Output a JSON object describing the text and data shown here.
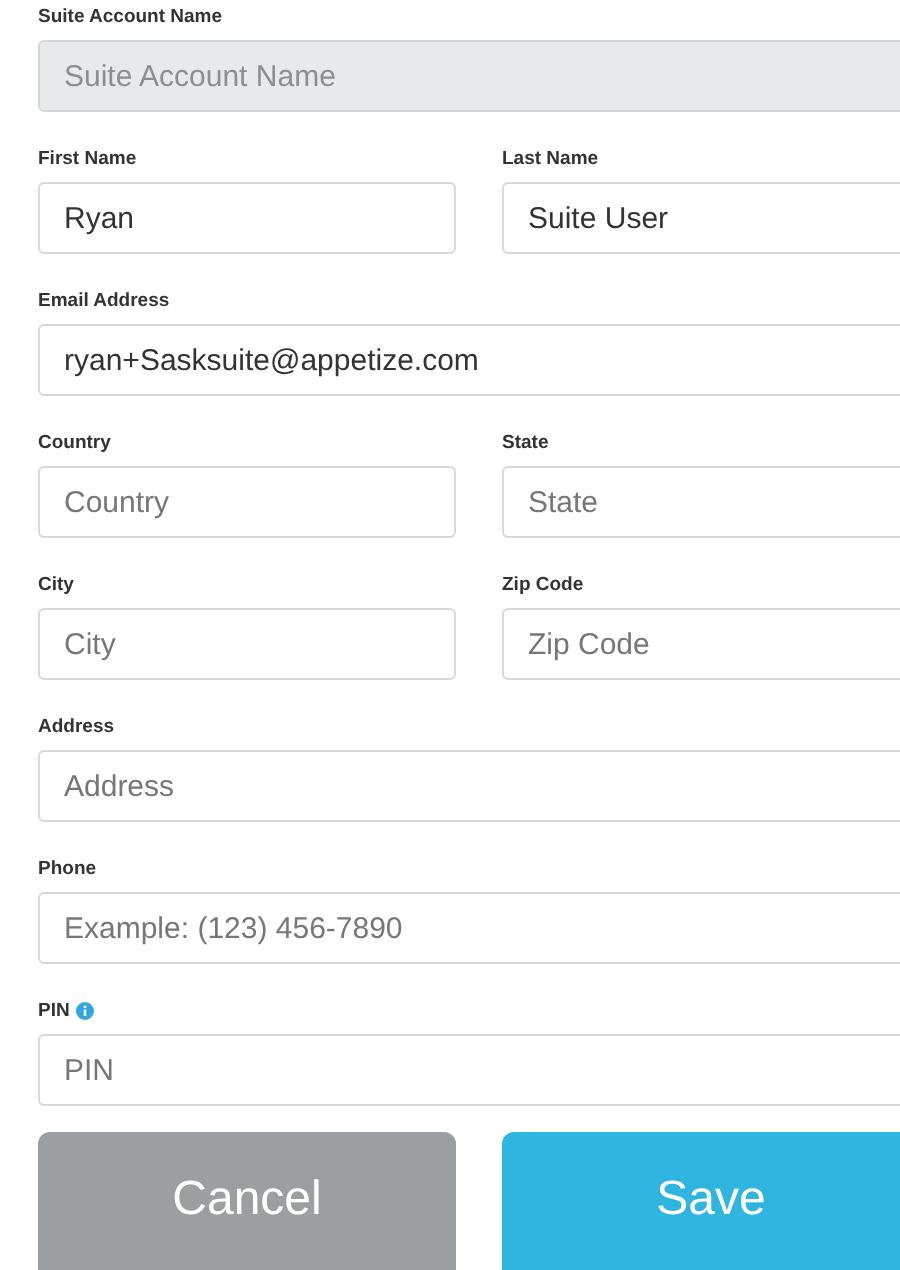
{
  "rows": [
    {
      "fields": [
        {
          "label": "Suite Account Name",
          "placeholder": "Suite Account Name",
          "disabled": true
        }
      ]
    },
    {
      "fields": [
        {
          "label": "First Name",
          "value": "Ryan",
          "disabled": false
        },
        {
          "label": "Last Name",
          "value": "Suite User",
          "disabled": false
        }
      ]
    },
    {
      "fields": [
        {
          "label": "Email Address",
          "value": "ryan+Sasksuite@appetize.com",
          "disabled": false
        }
      ]
    },
    {
      "fields": [
        {
          "label": "Country",
          "placeholder": "Country",
          "disabled": false
        },
        {
          "label": "State",
          "placeholder": "State",
          "disabled": false
        }
      ]
    },
    {
      "fields": [
        {
          "label": "City",
          "placeholder": "City",
          "disabled": false
        },
        {
          "label": "Zip Code",
          "placeholder": "Zip Code",
          "disabled": false
        }
      ]
    },
    {
      "fields": [
        {
          "label": "Address",
          "placeholder": "Address",
          "disabled": false
        }
      ]
    },
    {
      "fields": [
        {
          "label": "Phone",
          "placeholder": "Example: (123) 456-7890",
          "disabled": false
        }
      ]
    },
    {
      "fields": [
        {
          "label": "PIN",
          "placeholder": "PIN",
          "disabled": false,
          "info": true
        }
      ]
    }
  ],
  "buttons": [
    {
      "label": "Cancel",
      "kind": "cancel"
    },
    {
      "label": "Save",
      "kind": "save"
    }
  ]
}
